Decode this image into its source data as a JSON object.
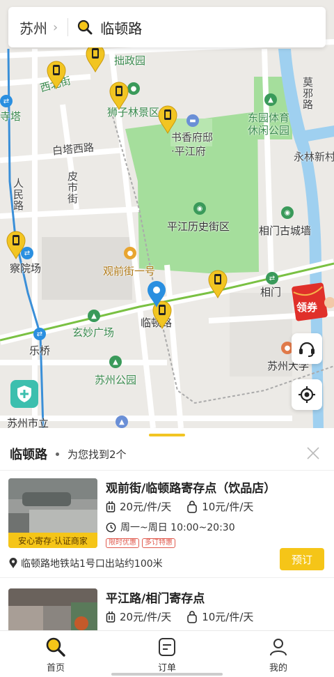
{
  "search": {
    "city": "苏州",
    "query": "临顿路"
  },
  "map": {
    "labels": {
      "zhuozhengyuan": "拙政园",
      "xibeijie": "西北街",
      "shizilin": "狮子林景区",
      "sitaa": "寺塔",
      "baitaxilu": "白塔西路",
      "pijie": "皮市街",
      "renminlu": "人民路",
      "shuxiang": "书香府邸",
      "pingjiangfu": "·平江府",
      "dongyuan1": "东园体育",
      "dongyuan2": "休闲公园",
      "moxielu": "莫邪路",
      "yonglin": "永林新村",
      "pingjianglishi": "平江历史街区",
      "xiangmengucheng": "相门古城墙",
      "chayuanchang": "察院场",
      "guanqianjie": "观前街一号",
      "xiangmen": "相门",
      "xuanmiao": "玄妙广场",
      "lindunlu": "临顿路",
      "leqiao": "乐桥",
      "suzhougongyuan": "苏州公园",
      "suzhoudaxue": "苏州大学",
      "suzhoushili": "苏州市立"
    },
    "coupon_label": "领券",
    "icons": {
      "locker_pin": "locker-pin-icon",
      "customer_service": "headset-icon",
      "locate": "locate-icon",
      "shield": "shield-plus-icon"
    },
    "colors": {
      "park": "#9fdb97",
      "water": "#9fd0f0",
      "pin": "#f2c522",
      "metro_line": "#7ac143"
    }
  },
  "sheet": {
    "title": "临顿路",
    "found_text": "为您找到2个",
    "results": [
      {
        "name": "观前街/临顿路寄存点（饮品店）",
        "price_large": "20元/件/天",
        "price_small": "10元/件/天",
        "hours": "周一~周日 10:00~20:30",
        "thumb_tag": "安心寄存·认证商家",
        "tags": [
          "限时优惠",
          "多订特惠"
        ],
        "address": "临顿路地铁站1号口出站约100米",
        "book_label": "预订"
      },
      {
        "name": "平江路/相门寄存点",
        "price_large": "20元/件/天",
        "price_small": "10元/件/天"
      }
    ]
  },
  "tabs": [
    {
      "label": "首页",
      "icon": "search-icon",
      "active": true
    },
    {
      "label": "订单",
      "icon": "order-icon",
      "active": false
    },
    {
      "label": "我的",
      "icon": "user-icon",
      "active": false
    }
  ],
  "accent_color": "#f5c518"
}
